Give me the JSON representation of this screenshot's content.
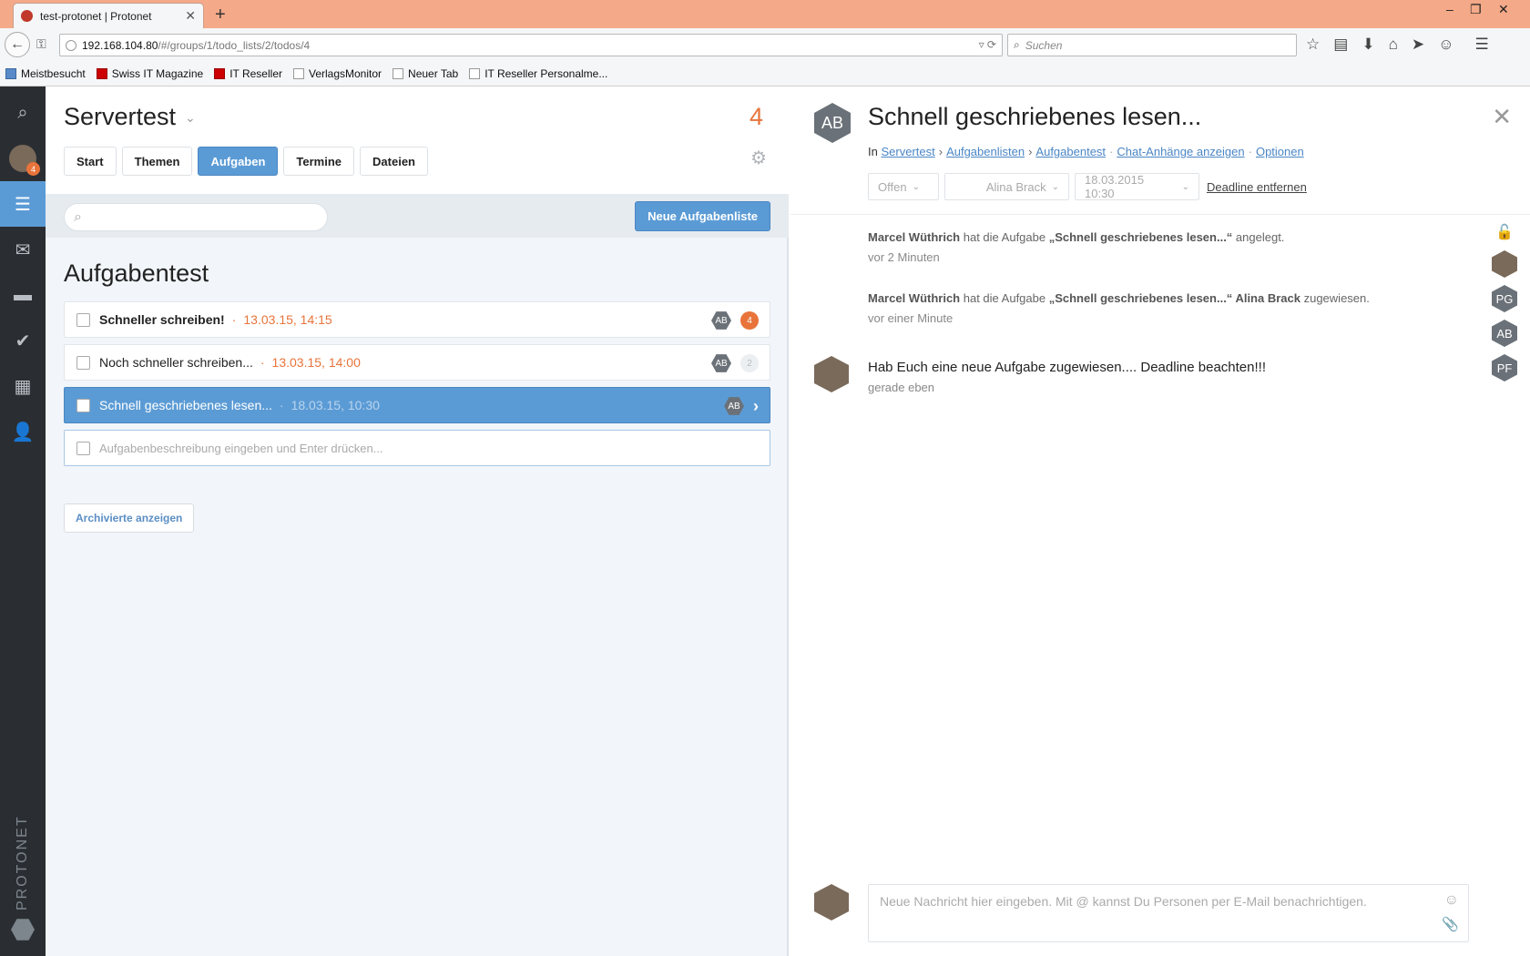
{
  "browser": {
    "tab_title": "test-protonet | Protonet",
    "url_host": "192.168.104.80",
    "url_path": "/#/groups/1/todo_lists/2/todos/4",
    "search_placeholder": "Suchen",
    "bookmarks": [
      "Meistbesucht",
      "Swiss IT Magazine",
      "IT Reseller",
      "VerlagsMonitor",
      "Neuer Tab",
      "IT Reseller Personalme..."
    ]
  },
  "sidebar": {
    "badge": "4",
    "brand": "PROTONET"
  },
  "group": {
    "title": "Servertest",
    "count": "4",
    "tabs": [
      "Start",
      "Themen",
      "Aufgaben",
      "Termine",
      "Dateien"
    ],
    "new_list_label": "Neue Aufgabenliste"
  },
  "todolist": {
    "title": "Aufgabentest",
    "items": [
      {
        "label": "Schneller schreiben!",
        "date": "13.03.15, 14:15",
        "assignee": "AB",
        "count": "4"
      },
      {
        "label": "Noch schneller schreiben...",
        "date": "13.03.15, 14:00",
        "assignee": "AB",
        "count": "2"
      },
      {
        "label": "Schnell geschriebenes lesen...",
        "date": "18.03.15, 10:30",
        "assignee": "AB"
      }
    ],
    "new_placeholder": "Aufgabenbeschreibung eingeben und Enter drücken...",
    "archived_label": "Archivierte anzeigen"
  },
  "detail": {
    "assignee": "AB",
    "title": "Schnell geschriebenes lesen...",
    "breadcrumb": {
      "in": "In",
      "group": "Servertest",
      "lists": "Aufgabenlisten",
      "list": "Aufgabentest",
      "attachments": "Chat-Anhänge anzeigen",
      "options": "Optionen"
    },
    "status": "Offen",
    "assigned_to": "Alina Brack",
    "deadline": "18.03.2015 10:30",
    "remove_deadline": "Deadline entfernen",
    "activities": [
      {
        "who": "Marcel Wüthrich",
        "pre": " hat die Aufgabe ",
        "task": "„Schnell geschriebenes lesen...“",
        "post": " angelegt.",
        "person": "",
        "time": "vor 2 Minuten"
      },
      {
        "who": "Marcel Wüthrich",
        "pre": " hat die Aufgabe ",
        "task": "„Schnell geschriebenes lesen...“",
        "post": " zugewiesen.",
        "person": " Alina Brack",
        "time": "vor einer Minute"
      }
    ],
    "comment": {
      "text": "Hab Euch eine neue Aufgabe zugewiesen.... Deadline beachten!!!",
      "time": "gerade eben"
    },
    "members": [
      "PG",
      "AB",
      "PF"
    ],
    "composer_placeholder": "Neue Nachricht hier eingeben. Mit @ kannst Du Personen per E-Mail benachrichtigen."
  }
}
